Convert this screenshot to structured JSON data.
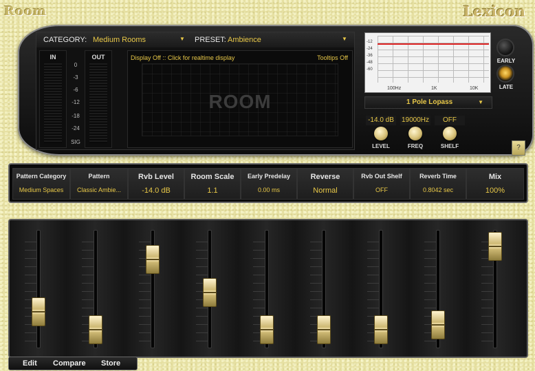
{
  "app": {
    "title": "Room",
    "brand": "Lexicon"
  },
  "selectors": {
    "category_label": "CATEGORY:",
    "category_value": "Medium Rooms",
    "preset_label": "PRESET:",
    "preset_value": "Ambience"
  },
  "meters": {
    "in_label": "IN",
    "out_label": "OUT",
    "scale": [
      "0",
      "-3",
      "-6",
      "-12",
      "-18",
      "-24",
      "SIG"
    ]
  },
  "display": {
    "status": "Display Off :: Click for realtime display",
    "tooltips": "Tooltips Off",
    "watermark": "ROOM"
  },
  "eq": {
    "db_labels": [
      "-12",
      "-24",
      "-36",
      "-48",
      "-60"
    ],
    "freq_labels": [
      "100Hz",
      "1K",
      "10K"
    ],
    "filter": "1 Pole Lopass"
  },
  "knobs": [
    {
      "value": "-14.0 dB",
      "label": "LEVEL"
    },
    {
      "value": "19000Hz",
      "label": "FREQ"
    },
    {
      "value": "OFF",
      "label": "SHELF"
    }
  ],
  "early_late": {
    "early": "EARLY",
    "late": "LATE"
  },
  "help": "?",
  "params": [
    {
      "name": "Pattern Category",
      "value": "Medium Spaces"
    },
    {
      "name": "Pattern",
      "value": "Classic Ambie..."
    },
    {
      "name": "Rvb Level",
      "value": "-14.0 dB"
    },
    {
      "name": "Room Scale",
      "value": "1.1"
    },
    {
      "name": "Early Predelay",
      "value": "0.00 ms"
    },
    {
      "name": "Reverse",
      "value": "Normal"
    },
    {
      "name": "Rvb Out Shelf",
      "value": "OFF"
    },
    {
      "name": "Reverb Time",
      "value": "0.8042 sec"
    },
    {
      "name": "Mix",
      "value": "100%"
    }
  ],
  "fader_levels": [
    0.25,
    0.05,
    0.83,
    0.46,
    0.05,
    0.05,
    0.05,
    0.1,
    0.98
  ],
  "buttons": {
    "edit": "Edit",
    "compare": "Compare",
    "store": "Store"
  }
}
